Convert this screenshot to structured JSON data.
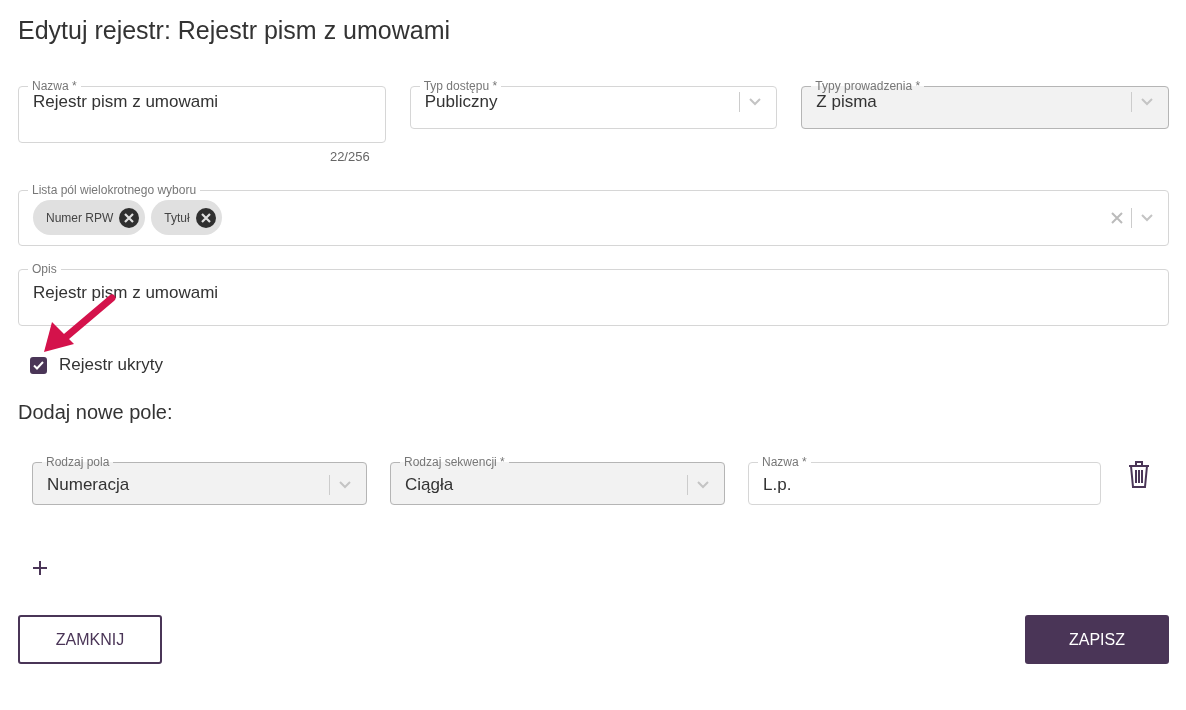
{
  "page_title": "Edytuj rejestr: Rejestr pism z umowami",
  "fields": [
    {
      "kind": "text",
      "label": "Nazwa *",
      "value": "Rejestr pism z umowami",
      "counter": "22/256",
      "disabled": false
    },
    {
      "kind": "select",
      "label": "Typ dostępu *",
      "value": "Publiczny",
      "disabled": false
    },
    {
      "kind": "select",
      "label": "Typy prowadzenia *",
      "value": "Z pisma",
      "disabled": true
    }
  ],
  "multi_select": {
    "label": "Lista pól wielokrotnego wyboru",
    "chips": [
      "Numer RPW",
      "Tytuł"
    ]
  },
  "description": {
    "label": "Opis",
    "value": "Rejestr pism z umowami"
  },
  "hidden_checkbox": {
    "label": "Rejestr ukryty",
    "checked": true
  },
  "new_field_section": {
    "heading": "Dodaj nowe pole:",
    "fields": [
      {
        "kind": "select",
        "label": "Rodzaj pola",
        "value": "Numeracja",
        "disabled": true
      },
      {
        "kind": "select",
        "label": "Rodzaj sekwencji *",
        "value": "Ciągła",
        "disabled": true
      },
      {
        "kind": "text",
        "label": "Nazwa *",
        "value": "L.p.",
        "disabled": false
      }
    ]
  },
  "buttons": [
    {
      "label": "ZAMKNIJ",
      "kind": "secondary"
    },
    {
      "label": "ZAPISZ",
      "kind": "primary"
    }
  ]
}
